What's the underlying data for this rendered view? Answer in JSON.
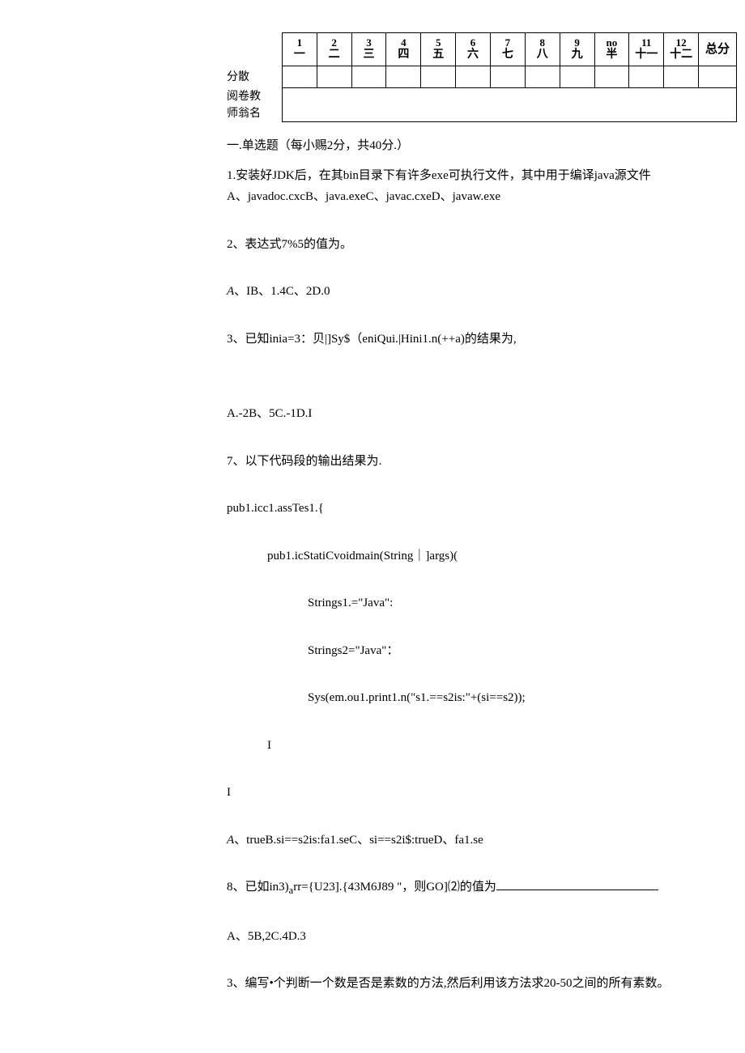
{
  "table": {
    "row_label_score": "分散",
    "row_label_teacher1": "阅卷教",
    "row_label_teacher2": "师翁名",
    "cols": [
      {
        "num": "1",
        "cn": "一"
      },
      {
        "num": "2",
        "cn": "二"
      },
      {
        "num": "3",
        "cn": "三"
      },
      {
        "num": "4",
        "cn": "四"
      },
      {
        "num": "5",
        "cn": "五"
      },
      {
        "num": "6",
        "cn": "六"
      },
      {
        "num": "7",
        "cn": "七"
      },
      {
        "num": "8",
        "cn": "八"
      },
      {
        "num": "9",
        "cn": "九"
      },
      {
        "num": "no",
        "cn": "半"
      },
      {
        "num": "11",
        "cn": "十一"
      },
      {
        "num": "12",
        "cn": "十二"
      }
    ],
    "total_label": "总分"
  },
  "section_title": "一.单选题（每小赐2分，共40分.）",
  "q1_line1": "1.安装好JDK后，在其bin目录下有许多exe可执行文件，其中用于编译java源文件",
  "q1_line2": "A、javadoc.cxcB、java.exeC、javac.cxeD、javaw.exe",
  "q2": "2、表达式7%5的值为。",
  "q2_opts_prefix": "A",
  "q2_opts_rest": "、IB、1.4C、2D.0",
  "q3": "3、已知inia=3：贝|]Sy$（eniQui.|Hini1.n(++a)的结果为,",
  "q3_opts": "A.-2B、5C.-1D.I",
  "q7": "7、以下代码段的输出结果为.",
  "code1": "pub1.icc1.assTes1.{",
  "code2": "pub1.icStatiCvoidmain(String｜]args)(",
  "code3": "Strings1.=\"Java\":",
  "code4": "Strings2=\"Java\"：",
  "code5": "Sys(em.ou1.print1.n(\"s1.==s2is:\"+(si==s2));",
  "brace1": "I",
  "brace2": "I",
  "q7_opts_prefix": "A",
  "q7_opts_rest": "、trueB.si==s2is:fa1.seC、si==s2i$:trueD、fa1.se",
  "q8_prefix": "8、已如in3)",
  "q8_sub": "a",
  "q8_mid": "rr={U23].{43M6J89 \"，则GO]⑵的值为",
  "q8_opts": "A、5B,2C.4D.3",
  "q_last": "3、编写•个判断一个数是否是素数的方法,然后利用该方法求20-50之间的所有素数。"
}
